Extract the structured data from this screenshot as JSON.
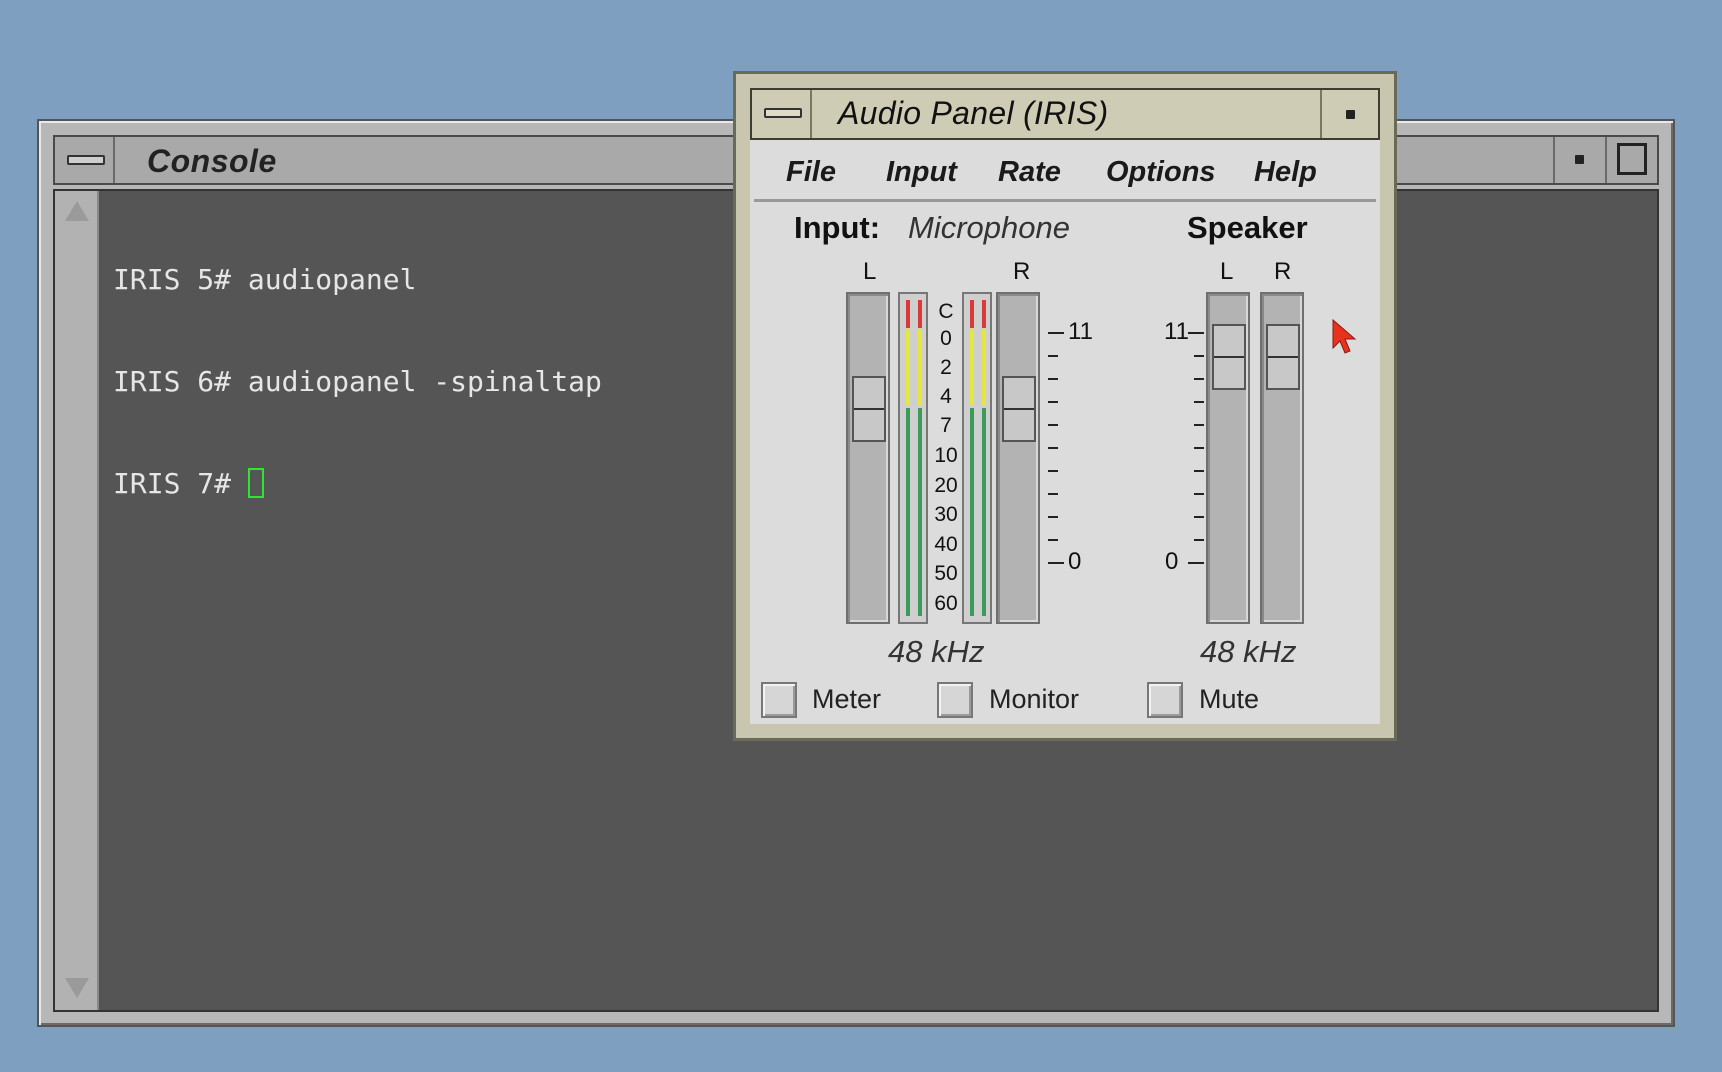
{
  "console": {
    "title": "Console",
    "lines": [
      "IRIS 5# audiopanel",
      "IRIS 6# audiopanel -spinaltap",
      "IRIS 7# "
    ],
    "cursor_color": "#2ee62e"
  },
  "audio_panel": {
    "title": "Audio Panel (IRIS)",
    "menu": [
      {
        "label": "File"
      },
      {
        "label": "Input"
      },
      {
        "label": "Rate"
      },
      {
        "label": "Options"
      },
      {
        "label": "Help"
      }
    ],
    "input_section": {
      "label": "Input:",
      "source": "Microphone",
      "left_label": "L",
      "right_label": "R",
      "db_scale": [
        "C",
        "0",
        "2",
        "4",
        "7",
        "10",
        "20",
        "30",
        "40",
        "50",
        "60"
      ],
      "gain_max": "11",
      "gain_min": "0",
      "rate": "48 kHz"
    },
    "speaker_section": {
      "label": "Speaker",
      "left_label": "L",
      "right_label": "R",
      "gain_max": "11",
      "gain_min": "0",
      "rate": "48 kHz"
    },
    "checkboxes": [
      {
        "label": "Meter",
        "checked": false
      },
      {
        "label": "Monitor",
        "checked": false
      },
      {
        "label": "Mute",
        "checked": false
      }
    ]
  },
  "colors": {
    "desktop": "#7f9fc1",
    "terminal_bg": "#555555",
    "meter_red": "#d83a3a",
    "meter_yellow": "#e6e640",
    "meter_green": "#3c9a5a",
    "pointer": "#e8321e"
  },
  "icons": [
    "window-menu-icon",
    "minimize-icon",
    "maximize-icon",
    "scroll-up-arrow-icon",
    "scroll-down-arrow-icon",
    "mouse-pointer-icon"
  ]
}
